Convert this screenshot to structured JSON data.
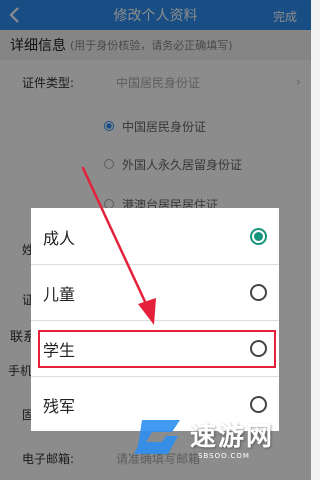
{
  "header": {
    "title": "修改个人资料",
    "done_label": "完成"
  },
  "section": {
    "title": "详细信息",
    "hint": "(用于身份核验，请务必正确填写)"
  },
  "id_type": {
    "label": "证件类型:",
    "value": "中国居民身份证",
    "options": [
      "中国居民身份证",
      "外国人永久居留身份证",
      "港澳台居民居住证"
    ]
  },
  "background_labels": {
    "row1": "姓",
    "row2": "证",
    "row3": "联系",
    "row4": "手机",
    "row5": "固"
  },
  "email": {
    "label": "电子邮箱:",
    "placeholder": "请准确填写邮箱"
  },
  "dialog": {
    "items": [
      {
        "label": "成人",
        "selected": true
      },
      {
        "label": "儿童",
        "selected": false
      },
      {
        "label": "学生",
        "selected": false
      },
      {
        "label": "残军",
        "selected": false
      }
    ],
    "highlighted": "学生"
  },
  "watermark": {
    "text": "速游网",
    "subtext": "SBSOO.COM"
  },
  "colors": {
    "header": "#2c8ef0",
    "selected_radio": "#17947c",
    "highlight": "#e5203a"
  }
}
